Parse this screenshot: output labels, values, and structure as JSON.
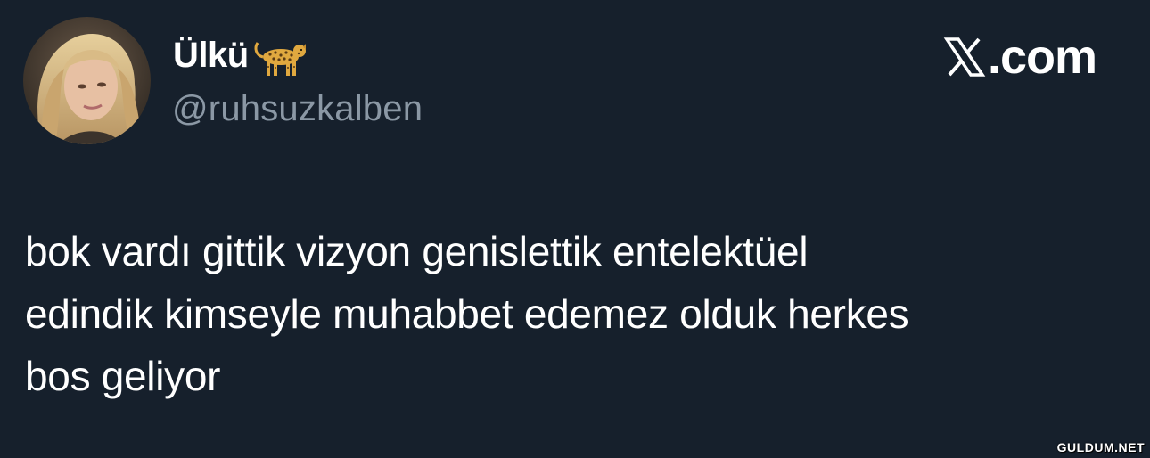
{
  "author": {
    "display_name": "Ülkü",
    "handle": "@ruhsuzkalben",
    "name_emoji": "leopard-icon"
  },
  "brand": {
    "logo": "x-logo-icon",
    "domain": ".com"
  },
  "tweet": {
    "lines": [
      "bok vardı gittik vizyon genislettik entelektüel",
      "edindik kimseyle muhabbet edemez olduk herkes",
      "bos geliyor"
    ]
  },
  "watermark": "GULDUM.NET",
  "colors": {
    "background": "#16202c",
    "text": "#ffffff",
    "handle": "#8b98a5"
  }
}
